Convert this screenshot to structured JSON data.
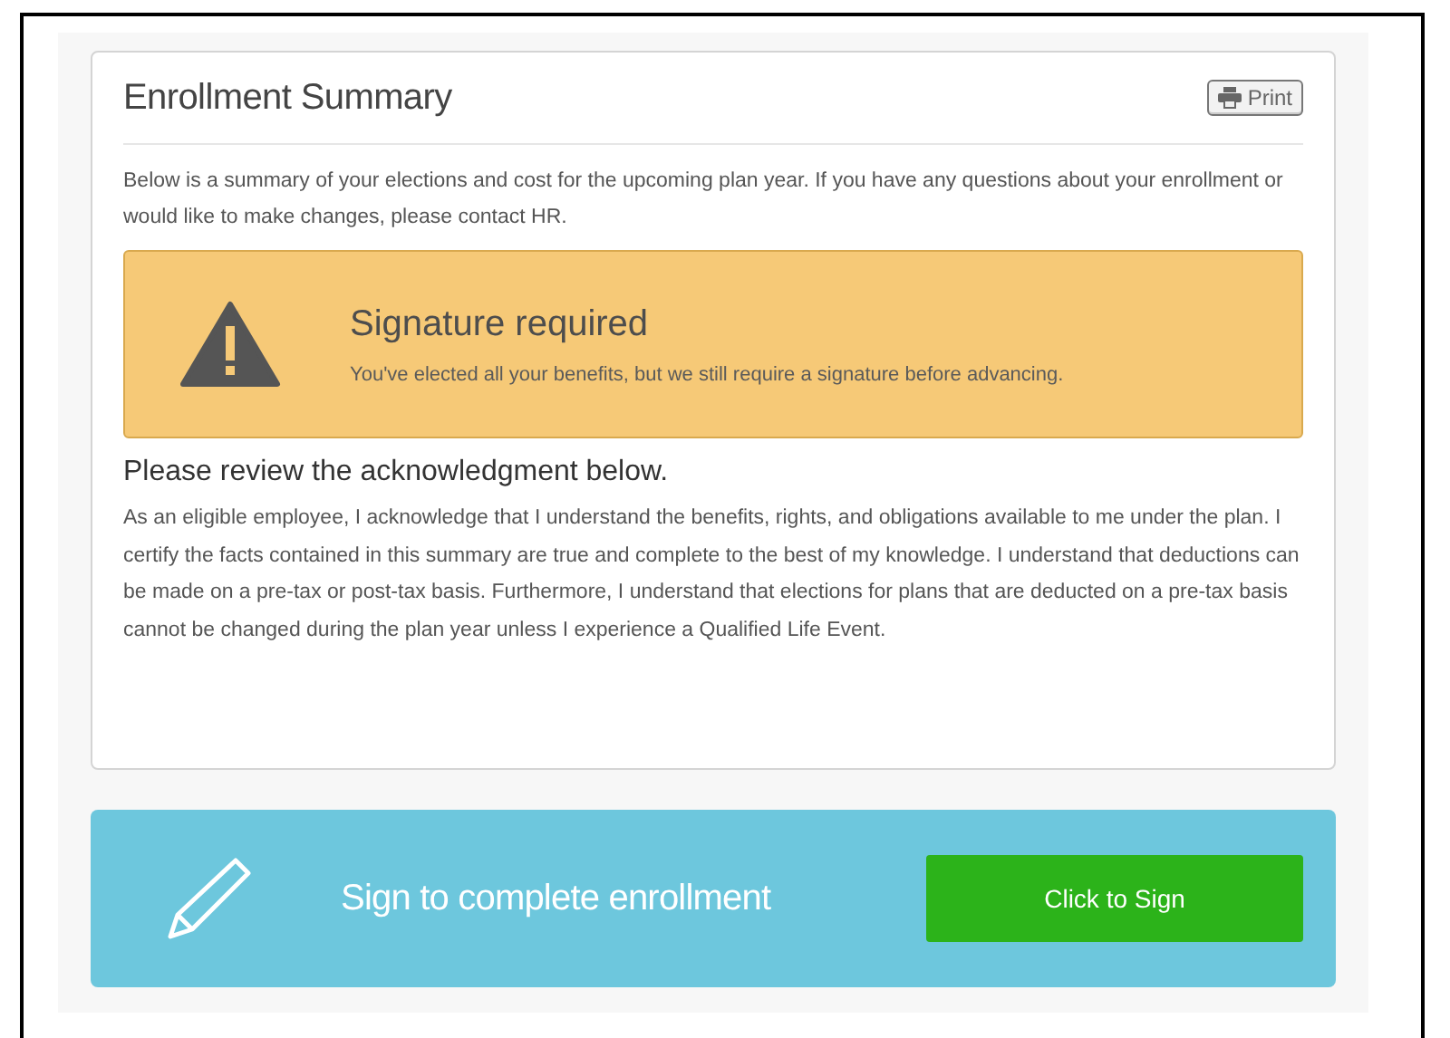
{
  "summary": {
    "title": "Enrollment Summary",
    "print_button": "Print",
    "intro": "Below is a summary of your elections and cost for the upcoming plan year. If you have any questions about your enrollment or would like to make changes, please contact HR."
  },
  "alert": {
    "title": "Signature required",
    "message": "You've elected all your benefits, but we still require a signature before advancing."
  },
  "acknowledgment": {
    "heading": "Please review the acknowledgment below.",
    "text": "As an eligible employee, I acknowledge that I understand the benefits, rights, and obligations available to me under the plan.  I certify the facts contained in this summary are true and complete to the best of my knowledge.  I understand that deductions can be made on a pre-tax or post-tax basis.   Furthermore, I understand that elections for plans that are deducted on a pre-tax basis cannot be changed during the plan year unless I experience a Qualified Life Event."
  },
  "sign_bar": {
    "label": "Sign to complete enrollment",
    "button": "Click to Sign"
  }
}
